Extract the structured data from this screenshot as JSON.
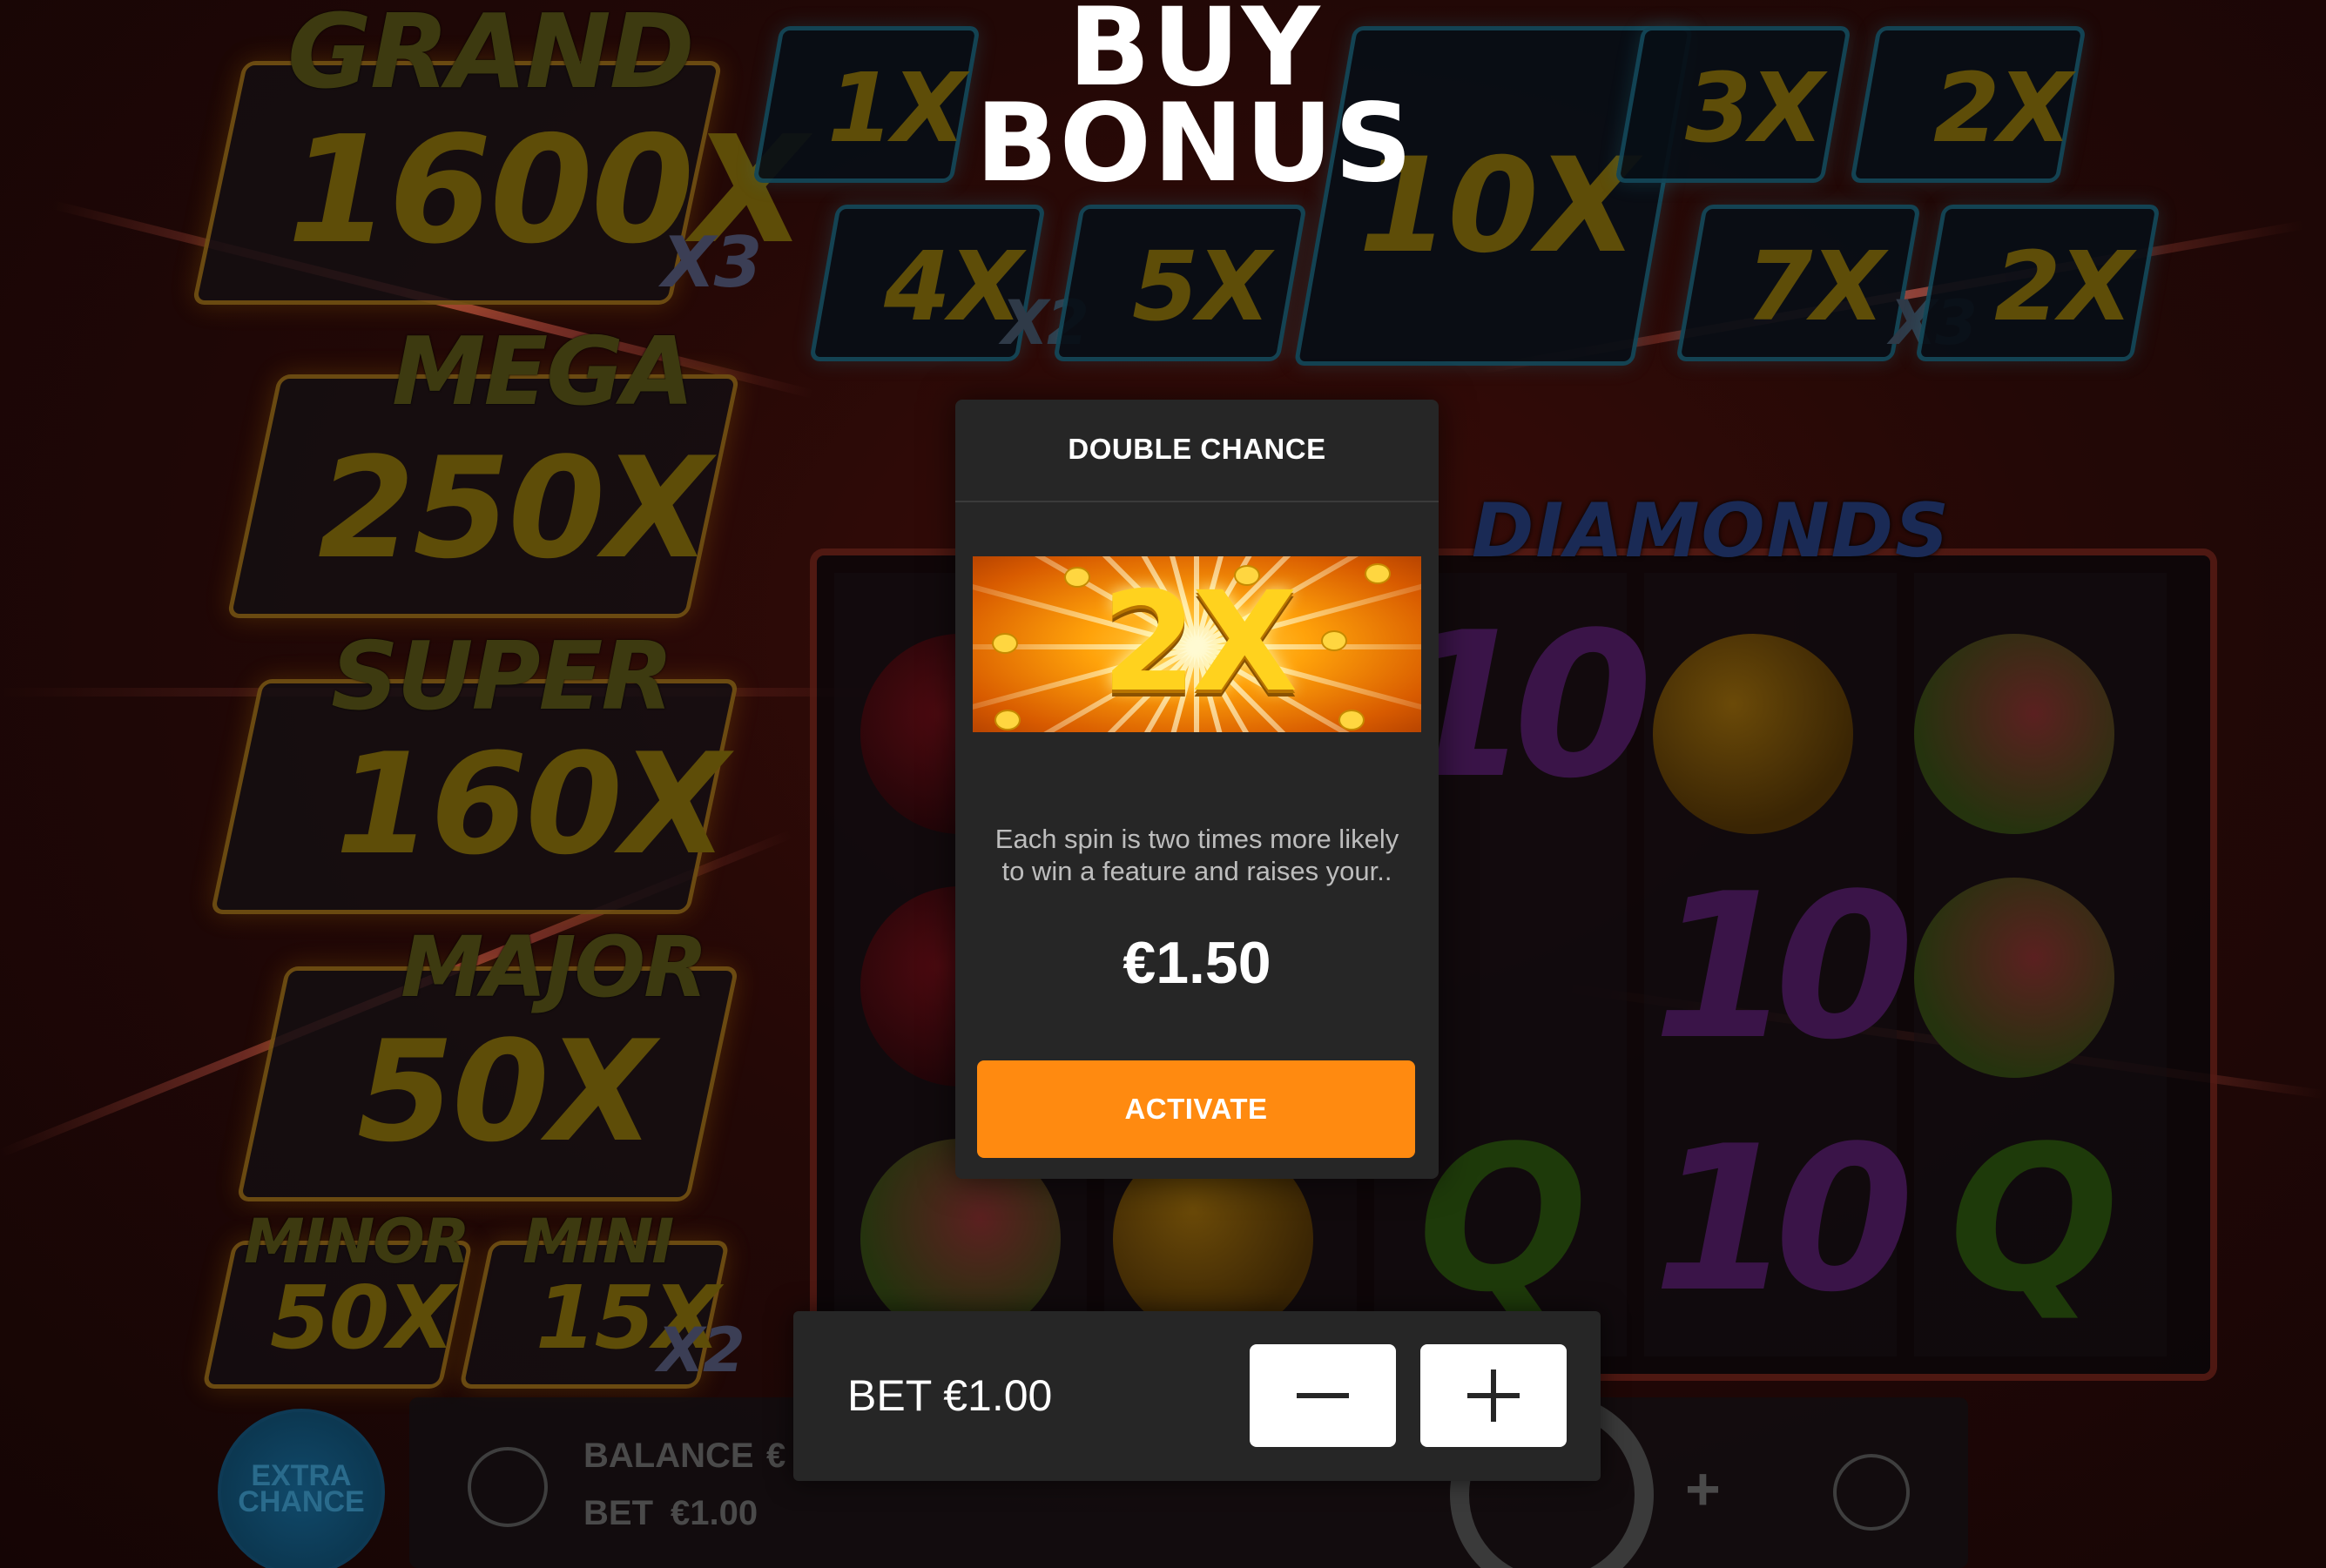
{
  "title": {
    "line1": "BUY",
    "line2": "BONUS"
  },
  "card": {
    "title": "DOUBLE CHANCE",
    "image_text": "2X",
    "description_line1": "Each spin is two times more likely",
    "description_line2": "to win a feature and raises your..",
    "price": "€1.50",
    "activate_label": "ACTIVATE"
  },
  "bet_panel": {
    "bet_text": "BET €1.00",
    "minus_icon": "minus-icon",
    "plus_icon": "plus-icon"
  },
  "background": {
    "jackpots": [
      {
        "name": "GRAND",
        "value": "1600X",
        "multiplier": "X3"
      },
      {
        "name": "MEGA",
        "value": "250X",
        "multiplier": ""
      },
      {
        "name": "SUPER",
        "value": "160X",
        "multiplier": ""
      },
      {
        "name": "MAJOR",
        "value": "50X",
        "multiplier": ""
      },
      {
        "name": "MINOR",
        "value": "50X",
        "multiplier": ""
      },
      {
        "name": "MINI",
        "value": "15X",
        "multiplier": "X2"
      }
    ],
    "multiplier_tiles": [
      {
        "value": "1X",
        "sub": ""
      },
      {
        "value": "10X",
        "sub": ""
      },
      {
        "value": "3X",
        "sub": ""
      },
      {
        "value": "2X",
        "sub": ""
      },
      {
        "value": "4X",
        "sub": "X2"
      },
      {
        "value": "5X",
        "sub": ""
      },
      {
        "value": "7X",
        "sub": "X3"
      },
      {
        "value": "2X",
        "sub": ""
      }
    ],
    "logo": "DIAMONDS",
    "reel_symbols": [
      "10",
      "10",
      "10",
      "Q",
      "Q"
    ],
    "extra_chance": {
      "line1": "EXTRA",
      "line2": "CHANCE"
    },
    "bottom_bar": {
      "balance_label": "BALANCE",
      "balance_value": "€",
      "bet_label": "BET",
      "bet_value": "€1.00"
    }
  },
  "colors": {
    "accent": "#ff8a10",
    "card_bg": "#262626",
    "text": "#ffffff",
    "muted_text": "#bdbdbd"
  }
}
